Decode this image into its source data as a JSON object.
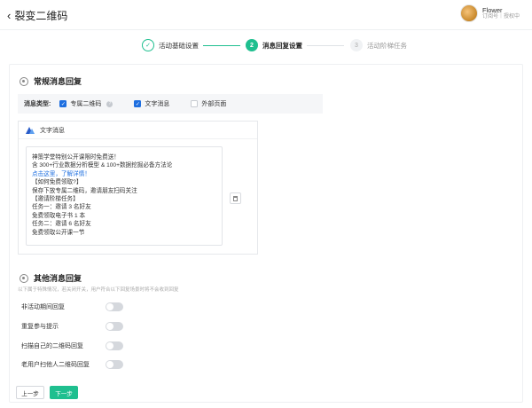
{
  "header": {
    "back_icon": "chevron-left-icon",
    "title": "裂变二维码",
    "user": {
      "name": "Flower",
      "role": "订阅号｜授权中"
    }
  },
  "steps": [
    {
      "number": "✓",
      "label": "活动基础设置",
      "state": "done"
    },
    {
      "number": "2",
      "label": "消息回复设置",
      "state": "active"
    },
    {
      "number": "3",
      "label": "活动阶梯任务",
      "state": "pending"
    }
  ],
  "regular": {
    "title": "常规消息回复",
    "type_label": "消息类型:",
    "options": [
      {
        "label": "专属二维码",
        "checked": true,
        "has_info": true
      },
      {
        "label": "文字消息",
        "checked": true
      },
      {
        "label": "外部页面",
        "checked": false
      }
    ],
    "panel_title": "文字消息",
    "lines": [
      "神策学堂特别公开课限时免费送！",
      "含 300+行业数据分析模型 & 100+数据挖掘必备方法论",
      "点击这里，了解详情！",
      "【如何免费领取?】",
      "保存下放专属二维码，邀请朋友扫码关注",
      "【邀请阶梯任务】",
      "任务一：邀请 3 名好友",
      "免费领取电子书 1 本",
      "任务二：邀请 6 名好友",
      "免费领取公开课一节"
    ],
    "link_line_index": 2
  },
  "other": {
    "title": "其他消息回复",
    "hint": "以下属于特殊情况，若关闭开关，用户符合以下回复场景时将不会收到回复",
    "toggles": [
      {
        "label": "非活动期间回复",
        "on": false
      },
      {
        "label": "重复参与提示",
        "on": false
      },
      {
        "label": "扫描自己的二维码回复",
        "on": false
      },
      {
        "label": "老用户扫他人二维码回复",
        "on": false
      }
    ]
  },
  "footer": {
    "prev_label": "上一步",
    "next_label": "下一步"
  },
  "colors": {
    "accent": "#1fbf8f",
    "checkbox": "#1e6fe0",
    "link": "#1e6fe0"
  }
}
